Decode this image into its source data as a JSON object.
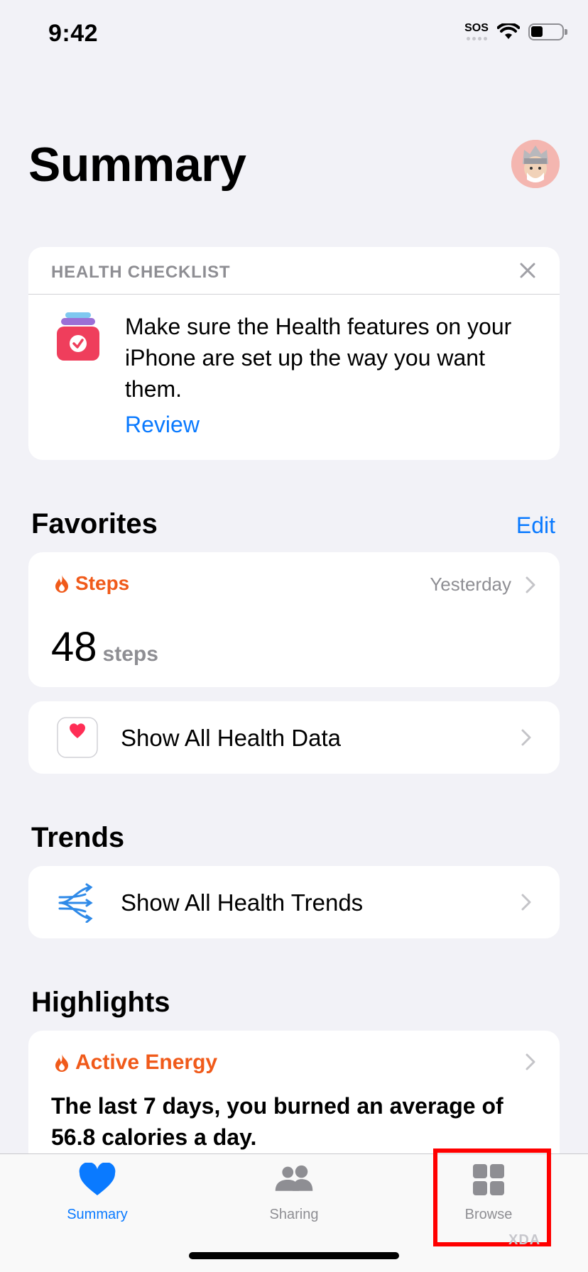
{
  "status_bar": {
    "time": "9:42",
    "sos": "SOS"
  },
  "header": {
    "title": "Summary"
  },
  "health_checklist": {
    "heading": "HEALTH CHECKLIST",
    "message": "Make sure the Health features on your iPhone are set up the way you want them.",
    "link": "Review"
  },
  "favorites": {
    "title": "Favorites",
    "edit": "Edit",
    "steps": {
      "label": "Steps",
      "when": "Yesterday",
      "value": "48",
      "unit": "steps"
    },
    "show_all": "Show All Health Data"
  },
  "trends": {
    "title": "Trends",
    "show_all": "Show All Health Trends"
  },
  "highlights": {
    "title": "Highlights",
    "energy_label": "Active Energy",
    "energy_text": "The last 7 days, you burned an average of 56.8 calories a day."
  },
  "tabbar": {
    "summary": "Summary",
    "sharing": "Sharing",
    "browse": "Browse",
    "active": "summary"
  },
  "watermark": "XDA",
  "colors": {
    "accent": "#0a7aff",
    "activity": "#f05a1a",
    "highlight": "#ff0000"
  }
}
